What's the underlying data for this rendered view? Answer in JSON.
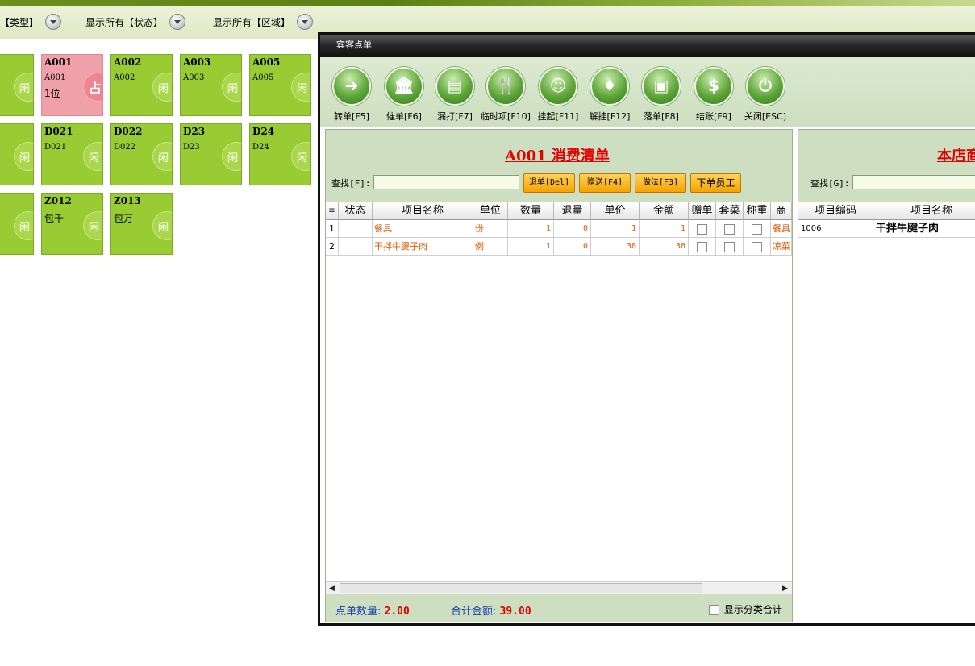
{
  "filters": [
    {
      "label": "【类型】"
    },
    {
      "label": "显示所有【状态】"
    },
    {
      "label": "显示所有【区域】"
    }
  ],
  "tiles": [
    {
      "code": "A001",
      "sub": "A001",
      "sub2": "1位",
      "badge": "占",
      "occupied": true
    },
    {
      "code": "A002",
      "sub": "A002",
      "badge": "闲"
    },
    {
      "code": "A003",
      "sub": "A003",
      "badge": "闲"
    },
    {
      "code": "A005",
      "sub": "A005",
      "badge": "闲"
    },
    {
      "code": "D021",
      "sub": "D021",
      "badge": "闲"
    },
    {
      "code": "D022",
      "sub": "D022",
      "badge": "闲"
    },
    {
      "code": "D23",
      "sub": "D23",
      "badge": "闲"
    },
    {
      "code": "D24",
      "sub": "D24",
      "badge": "闲"
    },
    {
      "code": "Z012",
      "sub": "包千",
      "badge": "闲"
    },
    {
      "code": "Z013",
      "sub": "包万",
      "badge": "闲"
    }
  ],
  "left_partial_badge": "闲",
  "window": {
    "title": "宾客点单"
  },
  "toolbar": [
    {
      "label": "转单[F5]",
      "icon": "forward-arrow-icon",
      "glyph": "➜"
    },
    {
      "label": "催单[F6]",
      "icon": "bank-building-icon",
      "glyph": "🏛"
    },
    {
      "label": "漏打[F7]",
      "icon": "document-icon",
      "glyph": "▤"
    },
    {
      "label": "临时项[F10]",
      "icon": "fork-spoon-icon",
      "glyph": "🍴"
    },
    {
      "label": "挂起[F11]",
      "icon": "waiter-icon",
      "glyph": "☺"
    },
    {
      "label": "解挂[F12]",
      "icon": "tie-icon",
      "glyph": "♦"
    },
    {
      "label": "落单[F8]",
      "icon": "screen-icon",
      "glyph": "▣"
    },
    {
      "label": "结账[F9]",
      "icon": "dollar-icon",
      "glyph": "$"
    },
    {
      "label": "关闭[ESC]",
      "icon": "power-icon",
      "glyph": "⏻"
    }
  ],
  "bill": {
    "title": "A001  消费清单",
    "search_label": "查找[F]:",
    "search_value": "",
    "buttons": [
      "退单[Del]",
      "赠送[F4]",
      "做法[F3]",
      "下单员工"
    ],
    "columns": [
      "",
      "状态",
      "项目名称",
      "单位",
      "数量",
      "退量",
      "单价",
      "金额",
      "赠单",
      "套菜",
      "称重",
      "商"
    ],
    "rows": [
      {
        "n": "1",
        "status": "",
        "name": "餐具",
        "unit": "份",
        "qty": "1",
        "ret": "0",
        "price": "1",
        "amount": "1",
        "cat": "餐具"
      },
      {
        "n": "2",
        "status": "",
        "name": "干拌牛腱子肉",
        "unit": "例",
        "qty": "1",
        "ret": "0",
        "price": "38",
        "amount": "38",
        "cat": "凉菜"
      }
    ],
    "footer": {
      "count_label": "点单数量:",
      "count_value": "2.00",
      "total_label": "合计金额:",
      "total_value": "39.00",
      "checkbox_label": "显示分类合计"
    }
  },
  "menu": {
    "title": "本店商",
    "search_label": "查找[G]:",
    "search_value": "",
    "columns": [
      "项目编码",
      "项目名称"
    ],
    "rows": [
      {
        "code": "1006",
        "name": "干拌牛腱子肉"
      }
    ]
  }
}
